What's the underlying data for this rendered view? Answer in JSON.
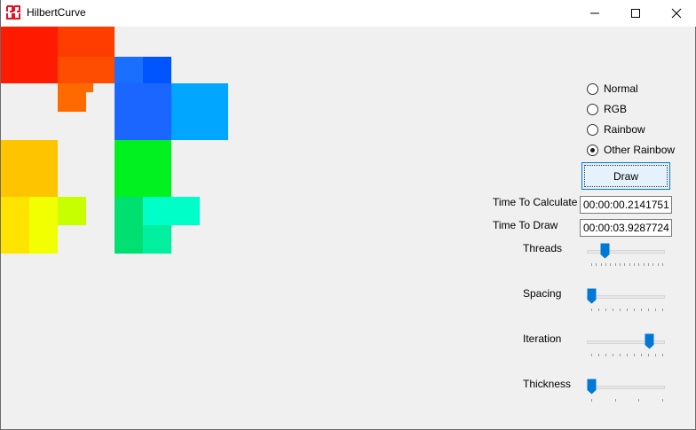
{
  "window": {
    "title": "HilbertCurve",
    "icon": "hilbert-app-icon",
    "controls": [
      "minimize-icon",
      "maximize-icon",
      "close-icon"
    ]
  },
  "color_modes": {
    "options": [
      "Normal",
      "RGB",
      "Rainbow",
      "Other Rainbow"
    ],
    "selected": "Other Rainbow"
  },
  "draw_button": {
    "label": "Draw"
  },
  "timing": {
    "calculate_label": "Time To Calculate",
    "calculate_value": "00:00:00.2141751",
    "draw_label": "Time To Draw",
    "draw_value": "00:00:03.9287724"
  },
  "sliders": {
    "threads": {
      "label": "Threads",
      "fraction": 0.2
    },
    "spacing": {
      "label": "Spacing",
      "fraction": 0.0
    },
    "iteration": {
      "label": "Iteration",
      "fraction": 0.85
    },
    "thickness": {
      "label": "Thickness",
      "fraction": 0.0
    }
  },
  "palette": {
    "accent": "#0078d7",
    "selection_bg": "#e5f1fb",
    "app_icon": "#e81123"
  }
}
